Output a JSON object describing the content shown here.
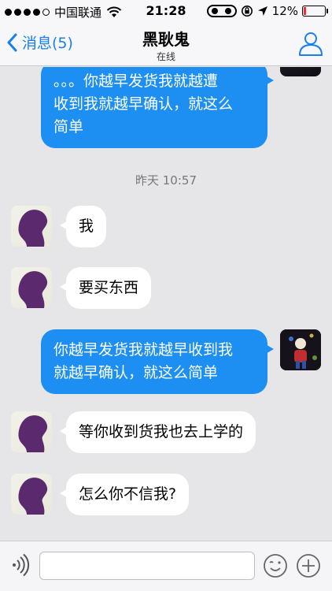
{
  "status_bar": {
    "carrier": "中国联通",
    "time": "21:28",
    "battery": "12%",
    "battery_level": 0.12,
    "signal_bars": 4,
    "icons": [
      "wifi-icon",
      "qq-icon",
      "lock-rotation-icon",
      "location-icon",
      "battery-icon"
    ]
  },
  "nav": {
    "back_label": "消息(5)",
    "title": "黑耿鬼",
    "subtitle": "在线",
    "icons": [
      "chevron-left-icon",
      "profile-icon"
    ]
  },
  "messages": [
    {
      "direction": "out",
      "text_lines": [
        "。。。你越早发货我就越遭",
        "收到我就越早确认，就这么",
        "简单"
      ]
    },
    {
      "type": "timestamp",
      "text": "昨天 10:57"
    },
    {
      "direction": "in",
      "text": "我"
    },
    {
      "direction": "in",
      "text": "要买东西"
    },
    {
      "direction": "out",
      "text_lines": [
        "你越早发货我就越早收到我",
        "就越早确认，就这么简单"
      ]
    },
    {
      "direction": "in",
      "text": "等你收到货我也去上学的"
    },
    {
      "direction": "in",
      "text": "怎么你不信我?"
    }
  ],
  "input_bar": {
    "placeholder": "",
    "icons": [
      "voice-icon",
      "emoji-icon",
      "plus-icon"
    ]
  },
  "colors": {
    "accent": "#1a7ef0",
    "outgoing_bubble": "#1d8ef2",
    "incoming_bubble": "#ffffff",
    "chat_background": "#e6e6e9"
  }
}
